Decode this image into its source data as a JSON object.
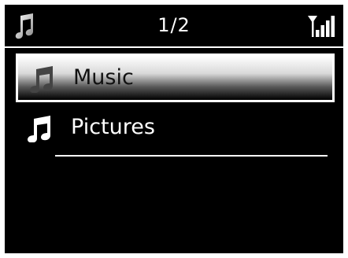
{
  "status_bar": {
    "page_indicator": "1/2",
    "left_icon": "music-note-icon",
    "right_icon": "wifi-signal-icon"
  },
  "menu": {
    "items": [
      {
        "label": "Music",
        "icon": "music-note-icon",
        "selected": true
      },
      {
        "label": "Pictures",
        "icon": "music-note-icon",
        "selected": false
      }
    ]
  },
  "colors": {
    "background": "#000000",
    "text": "#ffffff",
    "selected_text": "#111111",
    "highlight_border": "#ffffff"
  }
}
